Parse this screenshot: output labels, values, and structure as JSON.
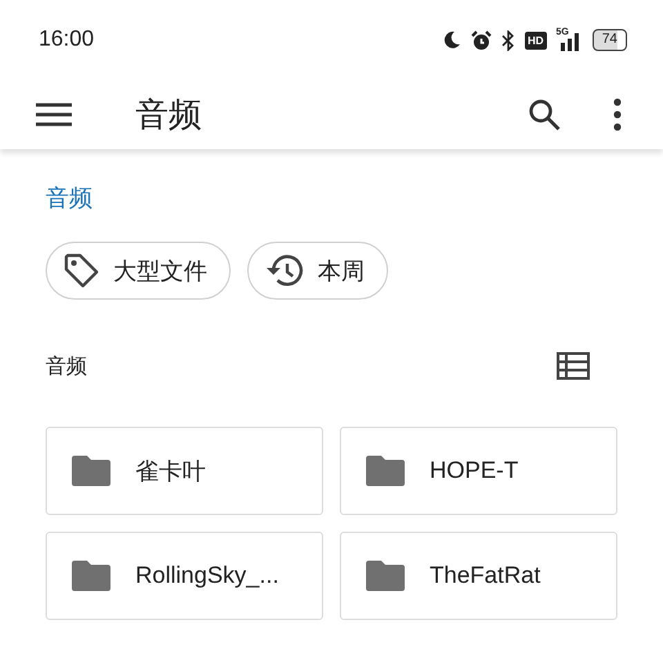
{
  "status_bar": {
    "time": "16:00",
    "hd": "HD",
    "network": "5G",
    "battery": "74"
  },
  "app_bar": {
    "title": "音频"
  },
  "breadcrumb": "音频",
  "chips": [
    {
      "label": "大型文件",
      "kind": "tag"
    },
    {
      "label": "本周",
      "kind": "history"
    }
  ],
  "section": {
    "title": "音频"
  },
  "folders": [
    {
      "name": "雀卡叶"
    },
    {
      "name": "HOPE-T"
    },
    {
      "name": "RollingSky_..."
    },
    {
      "name": "TheFatRat"
    }
  ]
}
